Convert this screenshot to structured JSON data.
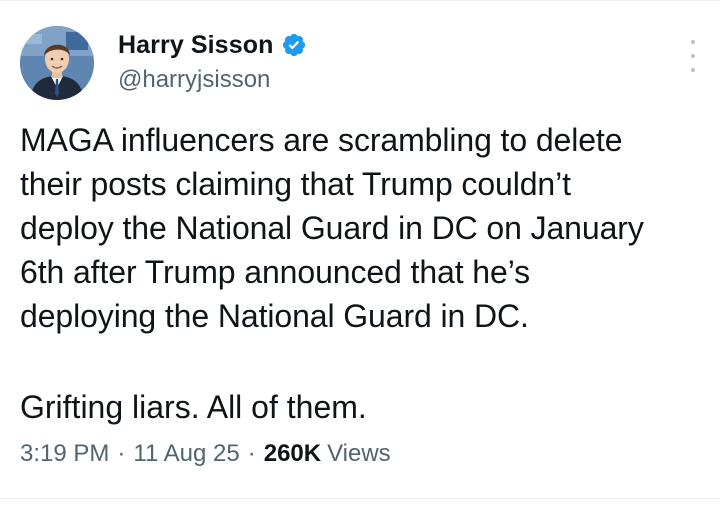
{
  "author": {
    "display_name": "Harry Sisson",
    "handle": "@harryjsisson",
    "verified": true,
    "avatar_icon": "profile-photo",
    "verified_icon": "verified-badge-icon",
    "verified_color": "#1d9bf0"
  },
  "tweet": {
    "text": "MAGA influencers are scrambling to delete\ntheir posts claiming that Trump couldn’t\ndeploy the National Guard in DC on January\n6th after Trump announced that he’s\ndeploying the National Guard in DC.",
    "text_second": "Grifting liars. All of them."
  },
  "meta": {
    "time": "3:19 PM",
    "separator": "·",
    "date": "11 Aug 25",
    "views_count": "260K",
    "views_label": "Views"
  },
  "menu": {
    "icon": "more-vertical-icon"
  }
}
